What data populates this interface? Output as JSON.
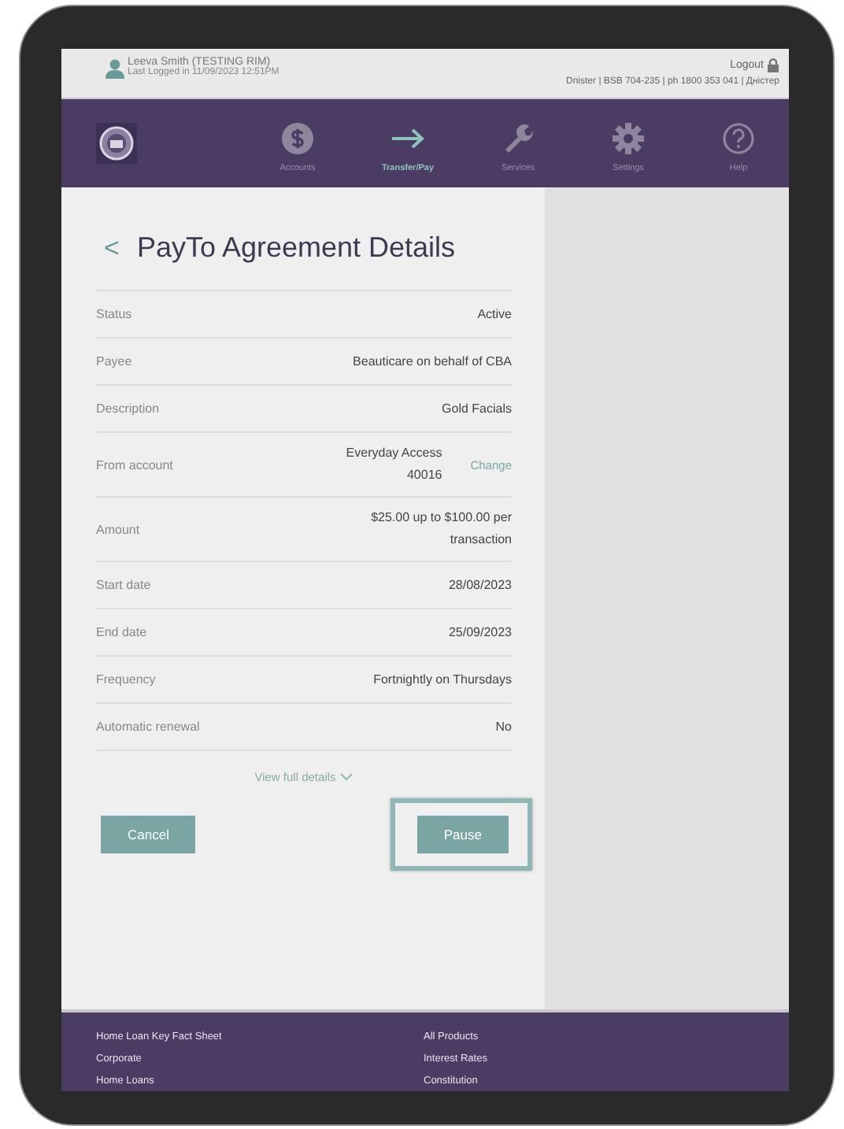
{
  "header": {
    "user_name": "Leeva Smith (TESTING RIM)",
    "last_login": "Last Logged in 11/09/2023 12:51PM",
    "logout": "Logout",
    "bank_info": "Dnister | BSB 704-235 | ph 1800 353 041 | Дністер"
  },
  "nav": [
    {
      "label": "Accounts",
      "selected": false
    },
    {
      "label": "Transfer/Pay",
      "selected": true
    },
    {
      "label": "Services",
      "selected": false
    },
    {
      "label": "Settings",
      "selected": false
    },
    {
      "label": "Help",
      "selected": false
    }
  ],
  "back": "<",
  "title": "PayTo Agreement Details",
  "rows": [
    {
      "label": "Status",
      "value": "Active"
    },
    {
      "label": "Payee",
      "value": "Beauticare on behalf of CBA"
    },
    {
      "label": "Description",
      "value": "Gold Facials"
    },
    {
      "label": "From account",
      "value": "Everyday Access\n40016",
      "action": "Change"
    },
    {
      "label": "Amount",
      "value": "$25.00 up to $100.00 per\ntransaction"
    },
    {
      "label": "Start date",
      "value": "28/08/2023"
    },
    {
      "label": "End date",
      "value": "25/09/2023"
    },
    {
      "label": "Frequency",
      "value": "Fortnightly on Thursdays"
    },
    {
      "label": "Automatic renewal",
      "value": "No"
    }
  ],
  "view_full_details": "View full details",
  "buttons": [
    {
      "label": "Cancel",
      "highlighted": false
    },
    {
      "label": "Pause",
      "highlighted": true
    }
  ],
  "footer": {
    "column_1": [
      "Home Loan Key Fact Sheet",
      "Corporate",
      "Home Loans"
    ],
    "column_2": [
      "All Products",
      "Interest Rates",
      "Constitution"
    ]
  }
}
